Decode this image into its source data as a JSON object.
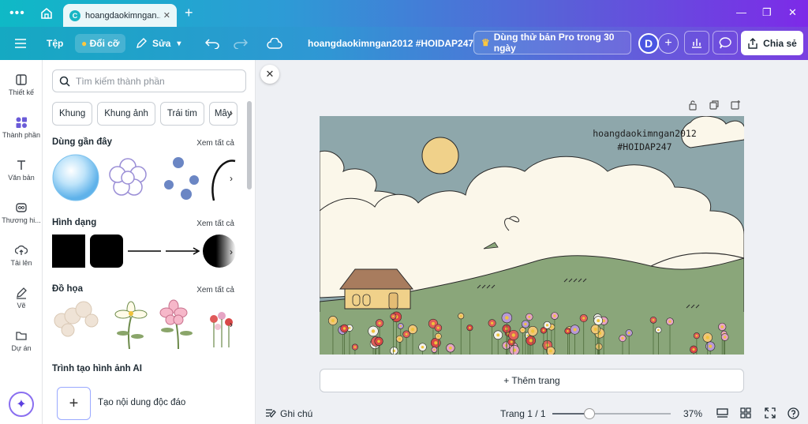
{
  "browser": {
    "tab_title": "hoangdaokimngan...",
    "tab_logo_letter": "C"
  },
  "toolbar": {
    "file_label": "Tệp",
    "resize_label": "Đổi cỡ",
    "edit_label": "Sửa",
    "doc_title": "hoangdaokimngan2012 #HOIDAP247",
    "pro_trial_label": "Dùng thử bản Pro trong 30 ngày",
    "avatar_letter": "D",
    "share_label": "Chia sẻ"
  },
  "rail": {
    "items": [
      {
        "label": "Thiết kế",
        "icon": "layout-icon"
      },
      {
        "label": "Thành phần",
        "icon": "elements-icon"
      },
      {
        "label": "Văn bản",
        "icon": "text-icon"
      },
      {
        "label": "Thương hi...",
        "icon": "brand-icon"
      },
      {
        "label": "Tải lên",
        "icon": "upload-icon"
      },
      {
        "label": "Vẽ",
        "icon": "draw-icon"
      },
      {
        "label": "Dự án",
        "icon": "folder-icon"
      }
    ]
  },
  "panel": {
    "search_placeholder": "Tìm kiếm thành phần",
    "chips": [
      "Khung",
      "Khung ảnh",
      "Trái tim",
      "Mây"
    ],
    "recent_title": "Dùng gần đây",
    "shapes_title": "Hình dạng",
    "graphics_title": "Đồ họa",
    "ai_title": "Trình tạo hình ảnh AI",
    "see_all": "Xem tất cả",
    "ai_create_label": "Tạo nội dung độc đáo"
  },
  "canvas": {
    "art_text_line1": "hoangdaokimngan2012",
    "art_text_line2": "#HOIDAP247",
    "add_page_label": "+ Thêm trang"
  },
  "footer": {
    "notes_label": "Ghi chú",
    "page_label": "Trang 1 / 1",
    "zoom_label": "37%",
    "zoom_value": 37
  },
  "colors": {
    "sky": "#8ea7ab",
    "cloud": "#fbf7ea",
    "hill": "#8aa67a",
    "sun": "#f0d18a",
    "accent": "#7d2ae8"
  }
}
